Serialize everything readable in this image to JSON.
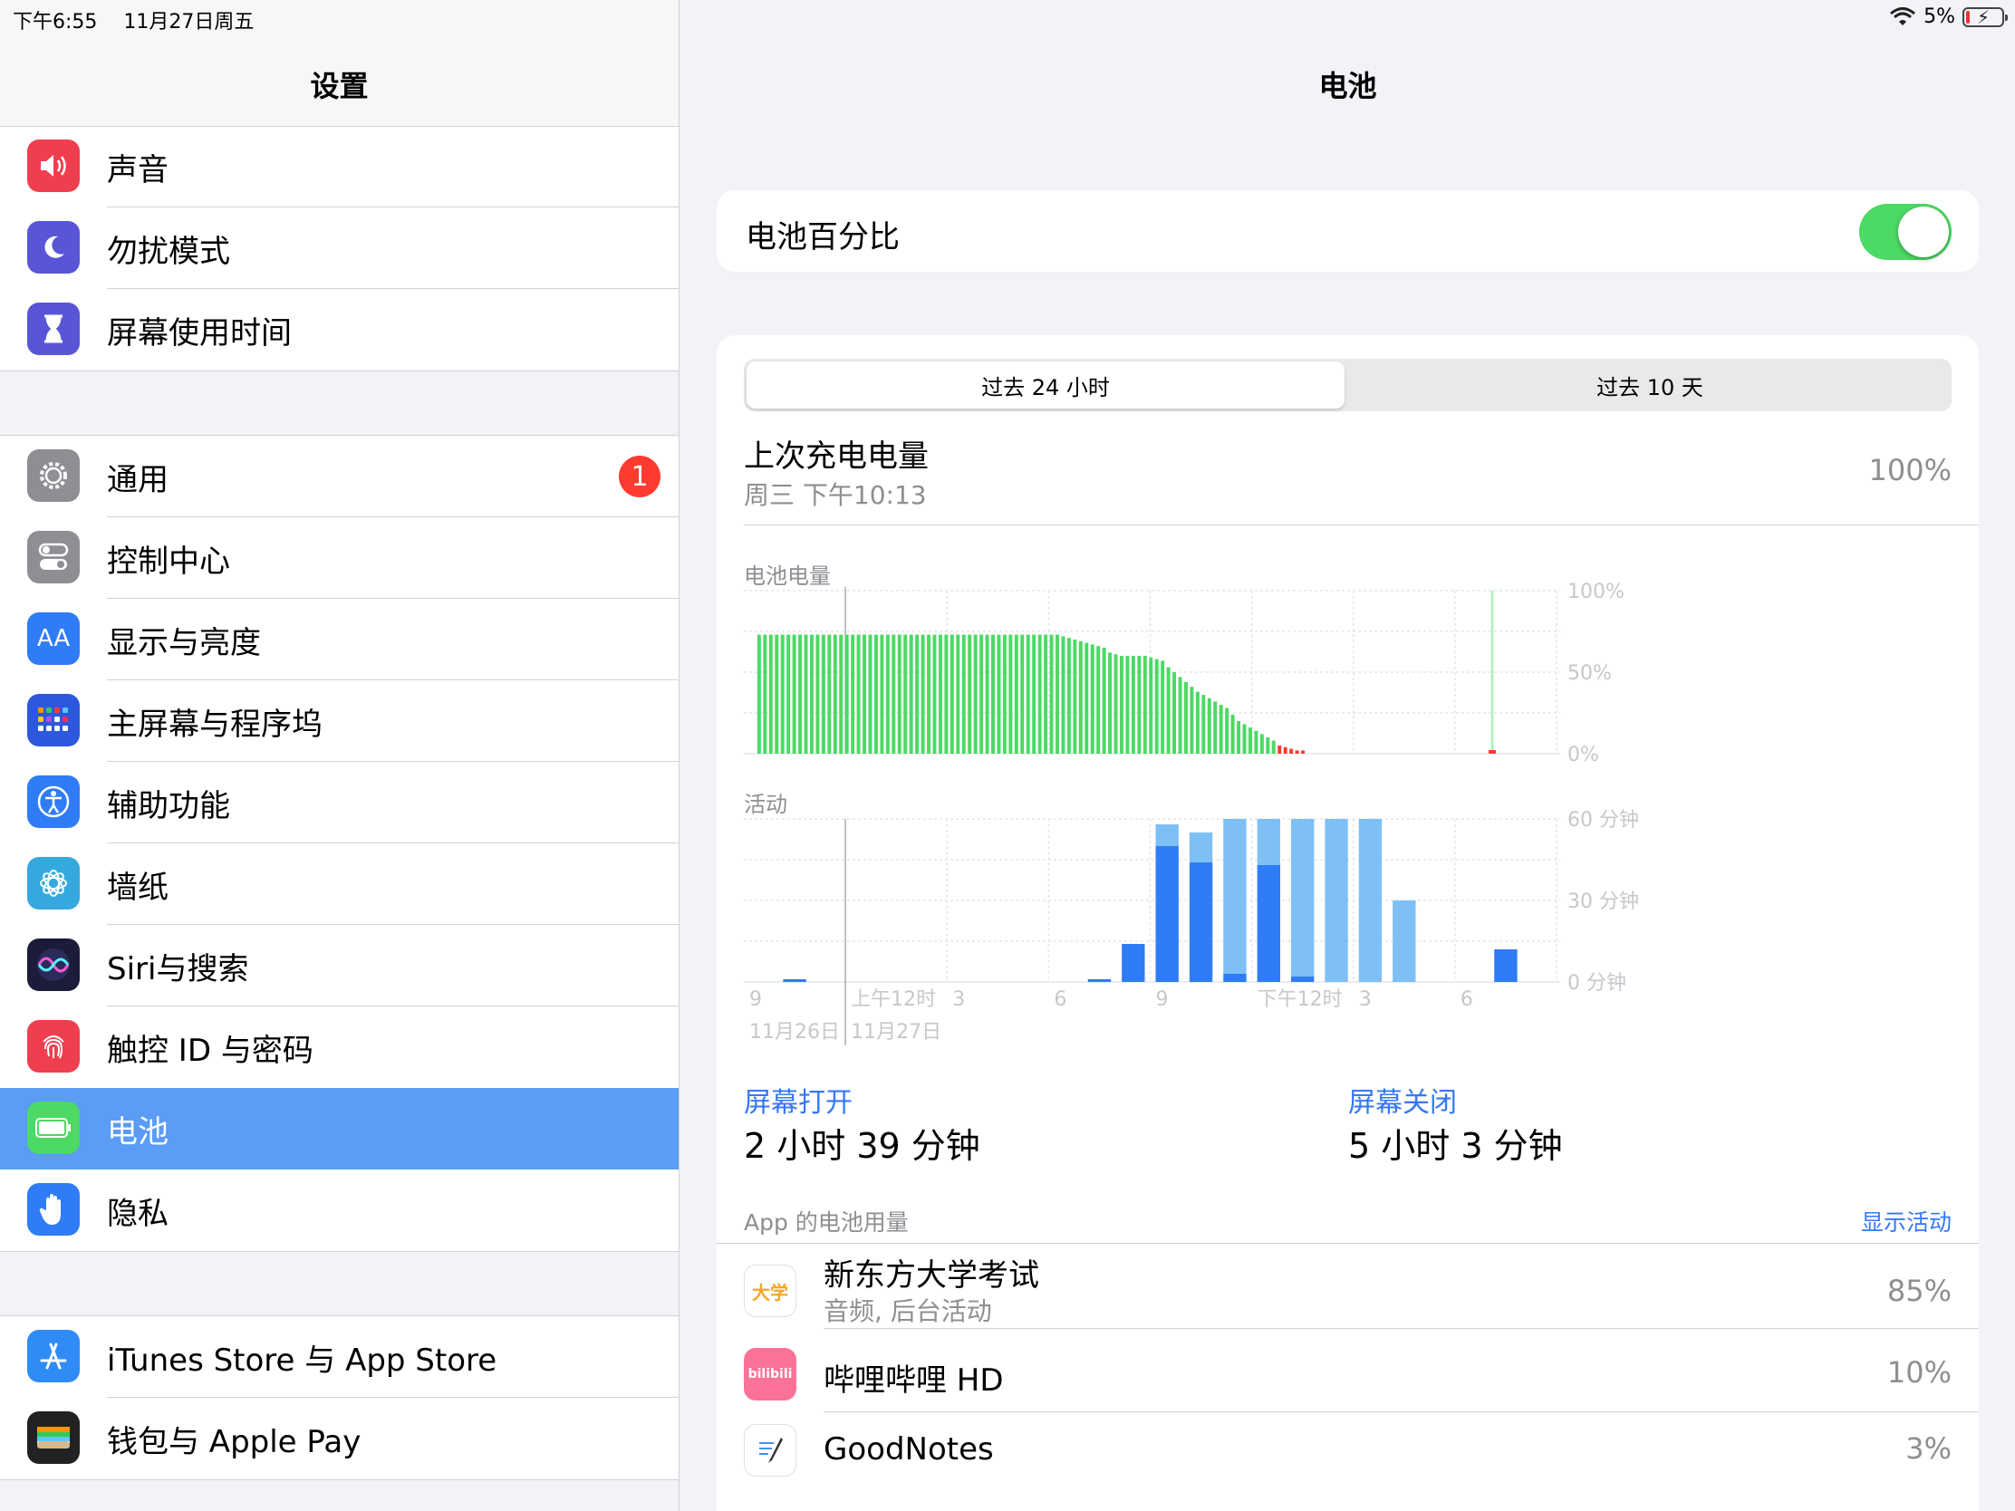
{
  "status_bar": {
    "time": "下午6:55",
    "date": "11月27日周五",
    "battery_pct": "5%",
    "battery_fill": 0.05
  },
  "sidebar": {
    "title": "设置",
    "group1": [
      {
        "label": "声音",
        "icon": "speaker-icon",
        "color": "#ef3f4f"
      },
      {
        "label": "勿扰模式",
        "icon": "moon-icon",
        "color": "#5856d6"
      },
      {
        "label": "屏幕使用时间",
        "icon": "hourglass-icon",
        "color": "#5856d6"
      }
    ],
    "group2": [
      {
        "label": "通用",
        "icon": "gear-icon",
        "color": "#8e8e93",
        "badge": "1"
      },
      {
        "label": "控制中心",
        "icon": "toggles-icon",
        "color": "#8e8e93"
      },
      {
        "label": "显示与亮度",
        "icon": "text-size-icon",
        "color": "#2f7cf6",
        "glyph": "AA"
      },
      {
        "label": "主屏幕与程序坞",
        "icon": "grid-icon",
        "color": "#2d58dd"
      },
      {
        "label": "辅助功能",
        "icon": "accessibility-icon",
        "color": "#2f7cf6"
      },
      {
        "label": "墙纸",
        "icon": "flower-icon",
        "color": "#35a8de"
      },
      {
        "label": "Siri与搜索",
        "icon": "siri-icon",
        "color": "#1c1c3a"
      },
      {
        "label": "触控 ID 与密码",
        "icon": "fingerprint-icon",
        "color": "#ef3f4f"
      },
      {
        "label": "电池",
        "icon": "battery-icon",
        "color": "#4cd964",
        "selected": true
      },
      {
        "label": "隐私",
        "icon": "hand-icon",
        "color": "#2f7cf6"
      }
    ],
    "group3": [
      {
        "label": "iTunes Store 与 App Store",
        "icon": "app-store-icon",
        "color": "#2f8cf6"
      },
      {
        "label": "钱包与 Apple Pay",
        "icon": "wallet-icon",
        "color": "#222222"
      }
    ]
  },
  "detail": {
    "title": "电池",
    "battery_percentage_label": "电池百分比",
    "battery_percentage_on": true,
    "tabs": [
      {
        "label": "过去 24 小时",
        "active": true
      },
      {
        "label": "过去 10 天",
        "active": false
      }
    ],
    "last_charge": {
      "title": "上次充电电量",
      "time": "周三 下午10:13",
      "value": "100%"
    },
    "screen_on": {
      "label": "屏幕打开",
      "value": "2 小时 39 分钟"
    },
    "screen_off": {
      "label": "屏幕关闭",
      "value": "5 小时 3 分钟"
    },
    "apps_header": "App 的电池用量",
    "apps_link": "显示活动",
    "apps": [
      {
        "name": "新东方大学考试",
        "sub": "音频, 后台活动",
        "pct": "85%",
        "icon": "xdf-app-icon",
        "icon_text": "大学"
      },
      {
        "name": "哔哩哔哩 HD",
        "sub": "",
        "pct": "10%",
        "icon": "bilibili-app-icon",
        "icon_text": "bilibili"
      },
      {
        "name": "GoodNotes",
        "sub": "",
        "pct": "3%",
        "icon": "goodnotes-app-icon",
        "icon_text": ""
      }
    ]
  },
  "chart_data": [
    {
      "type": "bar",
      "title": "电池电量",
      "y_ticks": [
        "100%",
        "50%",
        "0%"
      ],
      "ylim": [
        0,
        100
      ],
      "x_ticks": [
        "9",
        "上午12时",
        "3",
        "6",
        "9",
        "下午12时",
        "3",
        "6"
      ],
      "x_dates": [
        "11月26日",
        "11月27日"
      ],
      "start_bar": 2,
      "values": [
        73,
        73,
        73,
        73,
        73,
        73,
        73,
        73,
        73,
        73,
        73,
        73,
        73,
        73,
        73,
        73,
        73,
        73,
        73,
        73,
        73,
        73,
        73,
        73,
        73,
        73,
        73,
        73,
        73,
        73,
        73,
        73,
        73,
        73,
        73,
        73,
        73,
        73,
        73,
        73,
        73,
        73,
        73,
        73,
        73,
        73,
        73,
        73,
        73,
        73,
        73,
        73,
        72,
        71,
        70,
        69,
        68,
        67,
        66,
        65,
        62,
        61,
        60,
        60,
        60,
        60,
        60,
        59,
        58,
        57,
        53,
        50,
        47,
        44,
        41,
        38,
        36,
        34,
        32,
        30,
        28,
        24,
        20,
        18,
        16,
        14,
        12,
        10,
        8,
        5,
        4,
        3,
        2,
        2
      ],
      "charging_at": 128,
      "colors": {
        "normal": "#4cd964",
        "low": "#ff3b30",
        "low_threshold": 5
      }
    },
    {
      "type": "bar",
      "title": "活动",
      "y_ticks": [
        "60 分钟",
        "30 分钟",
        "0 分钟"
      ],
      "ylim": [
        0,
        60
      ],
      "x_ticks": [
        "9",
        "上午12时",
        "3",
        "6",
        "9",
        "下午12时",
        "3",
        "6"
      ],
      "x_dates": [
        "11月26日",
        "11月27日"
      ],
      "series": [
        {
          "name": "屏幕打开",
          "color": "#2f7cf6",
          "values": [
            0,
            1,
            0,
            0,
            0,
            0,
            0,
            0,
            0,
            0,
            1,
            14,
            50,
            44,
            3,
            43,
            2,
            0,
            0,
            0,
            0,
            0,
            12,
            0
          ]
        },
        {
          "name": "屏幕关闭",
          "color": "#7ec0f6",
          "values": [
            0,
            0,
            0,
            0,
            0,
            0,
            0,
            0,
            0,
            0,
            0,
            0,
            8,
            11,
            57,
            17,
            58,
            60,
            60,
            30,
            0,
            0,
            0,
            0
          ]
        }
      ]
    }
  ]
}
